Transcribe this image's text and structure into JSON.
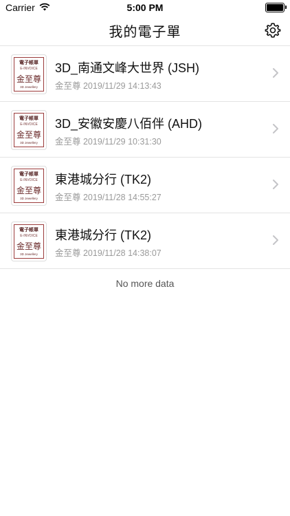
{
  "status": {
    "carrier": "Carrier",
    "time": "5:00 PM",
    "icons": [
      "wifi-icon",
      "battery-icon"
    ]
  },
  "nav": {
    "title": "我的電子單",
    "settings_icon": "gear-icon"
  },
  "invoices": [
    {
      "title": "3D_南通文峰大世界 (JSH)",
      "meta": "金至尊 2019/11/29 14:13:43"
    },
    {
      "title": "3D_安徽安慶八佰伴 (AHD)",
      "meta": "金至尊 2019/11/29 10:31:30"
    },
    {
      "title": "東港城分行 (TK2)",
      "meta": "金至尊 2019/11/28 14:55:27"
    },
    {
      "title": "東港城分行 (TK2)",
      "meta": "金至尊 2019/11/28 14:38:07"
    }
  ],
  "thumb": {
    "line1": "電子帳單",
    "line2": "E-INVOICE",
    "brand": "金至尊",
    "sub": "3D Jewellery"
  },
  "footer": {
    "no_more": "No more data"
  }
}
